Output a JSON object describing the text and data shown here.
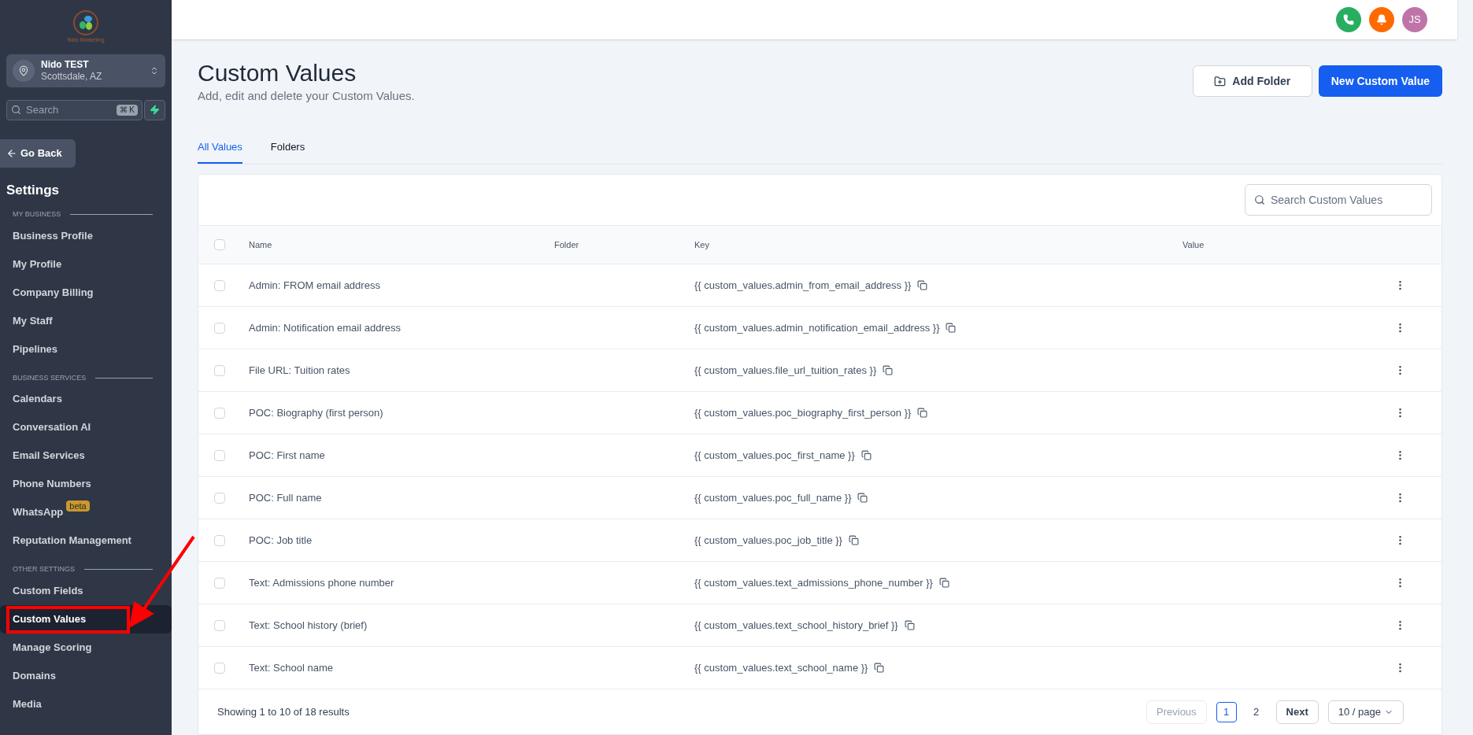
{
  "sidebar": {
    "brand": "Nido Marketing",
    "account": {
      "name": "Nido TEST",
      "location": "Scottsdale, AZ"
    },
    "search": {
      "placeholder": "Search",
      "shortcut": "⌘ K"
    },
    "back": "Go Back",
    "title": "Settings",
    "sections": [
      {
        "heading": "MY BUSINESS",
        "items": [
          {
            "label": "Business Profile",
            "selected": false
          },
          {
            "label": "My Profile",
            "selected": false
          },
          {
            "label": "Company Billing",
            "selected": false
          },
          {
            "label": "My Staff",
            "selected": false
          },
          {
            "label": "Pipelines",
            "selected": false
          }
        ]
      },
      {
        "heading": "BUSINESS SERVICES",
        "items": [
          {
            "label": "Calendars",
            "selected": false
          },
          {
            "label": "Conversation AI",
            "selected": false
          },
          {
            "label": "Email Services",
            "selected": false
          },
          {
            "label": "Phone Numbers",
            "selected": false
          },
          {
            "label": "WhatsApp",
            "selected": false,
            "badge": "beta"
          },
          {
            "label": "Reputation Management",
            "selected": false
          }
        ]
      },
      {
        "heading": "OTHER SETTINGS",
        "items": [
          {
            "label": "Custom Fields",
            "selected": false
          },
          {
            "label": "Custom Values",
            "selected": true,
            "highlighted": true
          },
          {
            "label": "Manage Scoring",
            "selected": false
          },
          {
            "label": "Domains",
            "selected": false
          },
          {
            "label": "Media",
            "selected": false
          }
        ]
      }
    ]
  },
  "header": {
    "avatar": "JS"
  },
  "page": {
    "title": "Custom Values",
    "subtitle": "Add, edit and delete your Custom Values.",
    "buttons": [
      {
        "label": "Add Folder",
        "kind": "secondary"
      },
      {
        "label": "New Custom Value",
        "kind": "primary"
      }
    ],
    "tabs": [
      {
        "label": "All Values",
        "selected": true
      },
      {
        "label": "Folders",
        "selected": false
      }
    ],
    "search": {
      "placeholder": "Search Custom Values"
    }
  },
  "table": {
    "select_all": {
      "checked": false
    },
    "columns": [
      "Name",
      "Folder",
      "Key",
      "Value"
    ],
    "rows": [
      {
        "checked": false,
        "name": "Admin: FROM email address",
        "key": "{{ custom_values.admin_from_email_address }}"
      },
      {
        "checked": false,
        "name": "Admin: Notification email address",
        "key": "{{ custom_values.admin_notification_email_address }}"
      },
      {
        "checked": false,
        "name": "File URL: Tuition rates",
        "key": "{{ custom_values.file_url_tuition_rates }}"
      },
      {
        "checked": false,
        "name": "POC: Biography (first person)",
        "key": "{{ custom_values.poc_biography_first_person }}"
      },
      {
        "checked": false,
        "name": "POC: First name",
        "key": "{{ custom_values.poc_first_name }}"
      },
      {
        "checked": false,
        "name": "POC: Full name",
        "key": "{{ custom_values.poc_full_name }}"
      },
      {
        "checked": false,
        "name": "POC: Job title",
        "key": "{{ custom_values.poc_job_title }}"
      },
      {
        "checked": false,
        "name": "Text: Admissions phone number",
        "key": "{{ custom_values.text_admissions_phone_number }}"
      },
      {
        "checked": false,
        "name": "Text: School history (brief)",
        "key": "{{ custom_values.text_school_history_brief }}"
      },
      {
        "checked": false,
        "name": "Text: School name",
        "key": "{{ custom_values.text_school_name }}"
      }
    ]
  },
  "pagination": {
    "summary": "Showing 1 to 10 of 18 results",
    "previous": "Previous",
    "pages": [
      {
        "label": "1",
        "selected": true
      },
      {
        "label": "2",
        "selected": false
      }
    ],
    "next": "Next",
    "page_size": "10 / page"
  }
}
